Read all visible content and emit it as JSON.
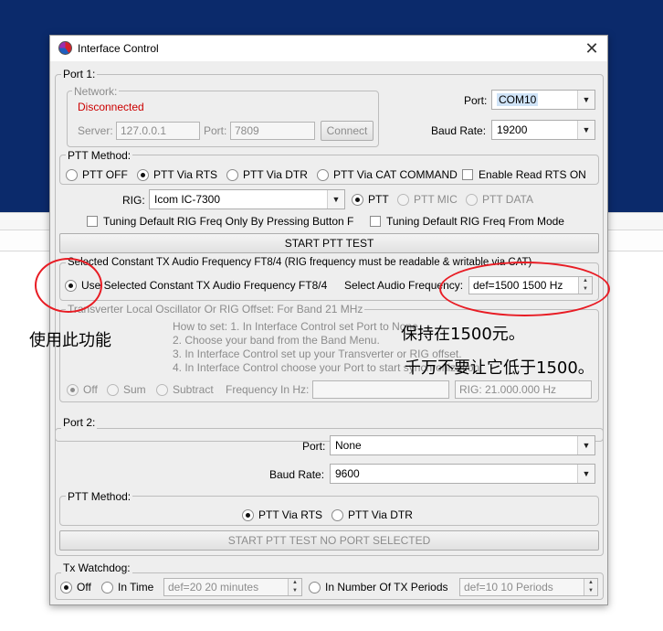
{
  "window": {
    "title": "Interface Control"
  },
  "port1": {
    "legend": "Port 1:",
    "network": {
      "legend": "Network:",
      "status": "Disconnected",
      "server_label": "Server:",
      "server_value": "127.0.0.1",
      "port_label": "Port:",
      "port_value": "7809",
      "connect_label": "Connect"
    },
    "port_label": "Port:",
    "port_value": "COM10",
    "baud_label": "Baud Rate:",
    "baud_value": "19200",
    "ptt_method": {
      "legend": "PTT Method:",
      "options": [
        "PTT OFF",
        "PTT Via RTS",
        "PTT Via DTR",
        "PTT Via CAT COMMAND"
      ],
      "selected": "PTT Via RTS",
      "enable_rts": "Enable Read RTS ON"
    },
    "rig_label": "RIG:",
    "rig_value": "Icom IC-7300",
    "rig_modes": [
      "PTT",
      "PTT MIC",
      "PTT DATA"
    ],
    "tuning1": "Tuning Default RIG Freq Only By Pressing Button F",
    "tuning2": "Tuning Default RIG Freq From Mode",
    "start_ptt_test": "START PTT TEST",
    "audio": {
      "legend": "Selected Constant TX Audio Frequency FT8/4 (RIG frequency must be readable & writable via CAT)",
      "use_label": "Use Selected Constant TX Audio Frequency FT8/4",
      "select_label": "Select Audio Frequency:",
      "value": "def=1500  1500  Hz"
    },
    "transverter": {
      "legend": "Transverter Local Oscillator Or RIG Offset:   For Band 21 MHz",
      "how": [
        "How to set: 1. In Interface Control set Port to None.",
        "2. Choose your band from the Band Menu.",
        "3. In Interface Control set up your Transverter or RIG offset.",
        "4. In Interface Control choose your Port to start synchronization."
      ],
      "modes": [
        "Off",
        "Sum",
        "Subtract"
      ],
      "freq_label": "Frequency In Hz:",
      "rig_value": "RIG: 21.000.000 Hz"
    }
  },
  "port2": {
    "legend": "Port 2:",
    "port_label": "Port:",
    "port_value": "None",
    "baud_label": "Baud Rate:",
    "baud_value": "9600",
    "ptt_method": {
      "legend": "PTT Method:",
      "options": [
        "PTT Via RTS",
        "PTT Via DTR"
      ]
    },
    "start_ptt_test": "START PTT TEST     NO PORT SELECTED"
  },
  "watchdog": {
    "legend": "Tx Watchdog:",
    "off": "Off",
    "in_time": "In Time",
    "time_value": "def=20  20  minutes",
    "in_number": "In Number Of TX Periods",
    "periods_value": "def=10  10  Periods"
  },
  "annotations": {
    "use_feature": "使用此功能",
    "keep_1500": "保持在1500元。",
    "not_below": "千万不要让它低于1500。"
  },
  "colors": {
    "background": "#0b2a6b",
    "status_red": "#cc0000",
    "annotation_red": "#e81c24"
  }
}
